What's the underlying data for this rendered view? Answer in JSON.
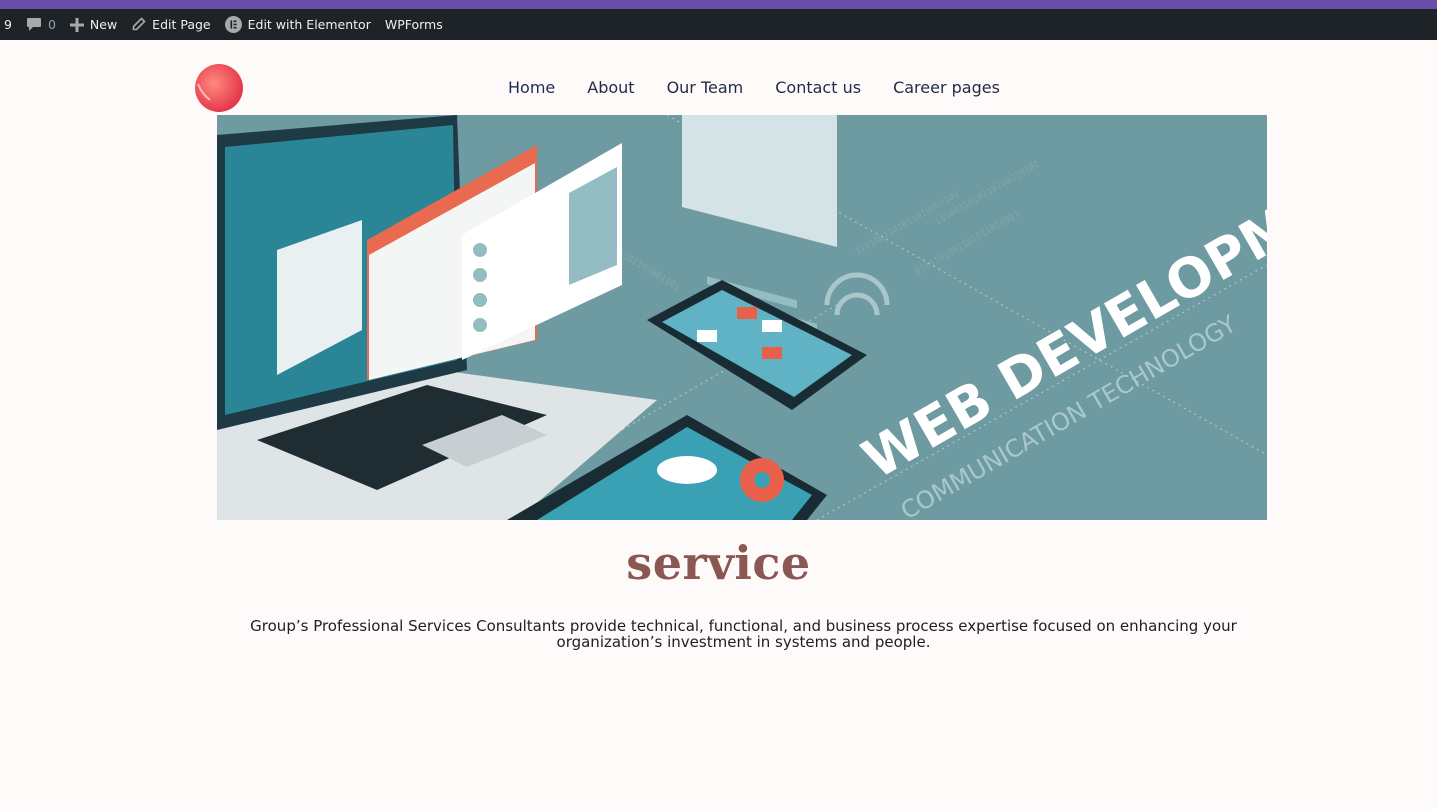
{
  "admin_bar": {
    "updates_count": "9",
    "comments_count": "0",
    "new_label": "New",
    "edit_page_label": "Edit Page",
    "elementor_label": "Edit with Elementor",
    "wpforms_label": "WPForms"
  },
  "nav": {
    "items": [
      {
        "label": "Home"
      },
      {
        "label": "About"
      },
      {
        "label": "Our Team"
      },
      {
        "label": "Contact us"
      },
      {
        "label": "Career pages"
      }
    ]
  },
  "hero": {
    "headline": "WEB DEVELOPMENT",
    "subline": "COMMUNICATION TECHNOLOGY"
  },
  "main": {
    "title": "service",
    "description": "Group’s Professional Services Consultants provide technical, functional, and business process expertise focused on enhancing your organization’s investment in systems and people."
  },
  "colors": {
    "admin_bar_bg": "#1d2327",
    "accent_stripe": "#6a4fa8",
    "page_bg": "#fffafa",
    "title_color": "#8a5753",
    "hero_bg": "#6e9aa2",
    "logo_red": "#e9505a"
  }
}
